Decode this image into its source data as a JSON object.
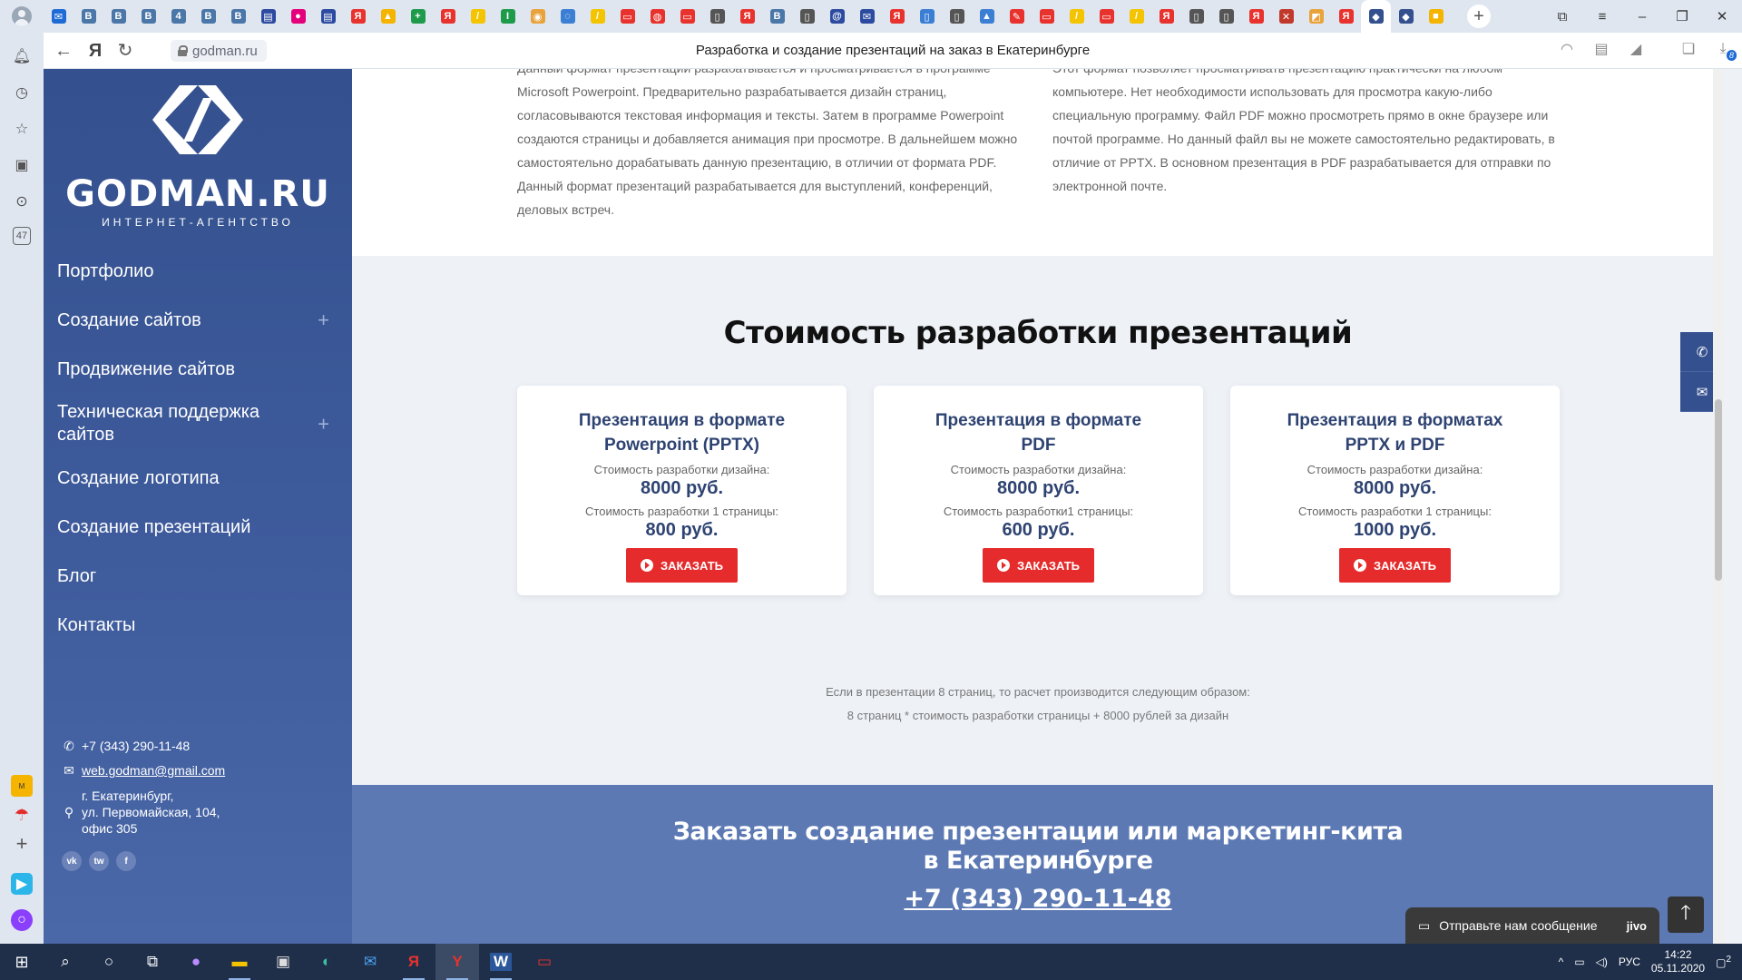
{
  "browser": {
    "tabs": [
      {
        "icon": "mail-icon",
        "glyph": "✉",
        "color": "#1f6bd6"
      },
      {
        "icon": "vk-icon",
        "glyph": "В",
        "color": "#4a76a8"
      },
      {
        "icon": "vk-icon",
        "glyph": "В",
        "color": "#4a76a8"
      },
      {
        "icon": "vk-icon",
        "glyph": "В",
        "color": "#4a76a8"
      },
      {
        "icon": "vk-icon",
        "glyph": "4",
        "color": "#4a76a8"
      },
      {
        "icon": "vk-icon",
        "glyph": "В",
        "color": "#4a76a8"
      },
      {
        "icon": "vk-icon",
        "glyph": "В",
        "color": "#4a76a8"
      },
      {
        "icon": "page-icon",
        "glyph": "▤",
        "color": "#2b4aa0"
      },
      {
        "icon": "chat-icon",
        "glyph": "●",
        "color": "#e4007c"
      },
      {
        "icon": "page-icon",
        "glyph": "▤",
        "color": "#2b4aa0"
      },
      {
        "icon": "yandex-icon",
        "glyph": "Я",
        "color": "#e8322d"
      },
      {
        "icon": "drive-icon",
        "glyph": "▲",
        "color": "#f4b400"
      },
      {
        "icon": "sheets-icon",
        "glyph": "+",
        "color": "#1e9b4a"
      },
      {
        "icon": "yandex-icon",
        "glyph": "Я",
        "color": "#e8322d"
      },
      {
        "icon": "pencil-icon",
        "glyph": "/",
        "color": "#f4c400"
      },
      {
        "icon": "sheets-icon",
        "glyph": "I",
        "color": "#1e9b4a"
      },
      {
        "icon": "chrome-icon",
        "glyph": "◉",
        "color": "#e8a33d"
      },
      {
        "icon": "doc-icon",
        "glyph": "◌",
        "color": "#3b7fd4"
      },
      {
        "icon": "pencil-icon",
        "glyph": "/",
        "color": "#f4c400"
      },
      {
        "icon": "pdf-icon",
        "glyph": "▭",
        "color": "#e8322d"
      },
      {
        "icon": "pdf-icon",
        "glyph": "◍",
        "color": "#e8322d"
      },
      {
        "icon": "pdf-icon",
        "glyph": "▭",
        "color": "#e8322d"
      },
      {
        "icon": "file-icon",
        "glyph": "▯",
        "color": "#555555"
      },
      {
        "icon": "yandex-icon",
        "glyph": "Я",
        "color": "#e8322d"
      },
      {
        "icon": "vk-icon",
        "glyph": "В",
        "color": "#4a76a8"
      },
      {
        "icon": "file-icon",
        "glyph": "▯",
        "color": "#555555"
      },
      {
        "icon": "at-icon",
        "glyph": "@",
        "color": "#2b4aa0"
      },
      {
        "icon": "mail-icon",
        "glyph": "✉",
        "color": "#2b4aa0"
      },
      {
        "icon": "yandex-icon",
        "glyph": "Я",
        "color": "#e8322d"
      },
      {
        "icon": "doc-icon",
        "glyph": "▯",
        "color": "#3b7fd4"
      },
      {
        "icon": "file-icon",
        "glyph": "▯",
        "color": "#555555"
      },
      {
        "icon": "drive-icon",
        "glyph": "▲",
        "color": "#3b7fd4"
      },
      {
        "icon": "pen-icon",
        "glyph": "✎",
        "color": "#e8322d"
      },
      {
        "icon": "pdf-icon",
        "glyph": "▭",
        "color": "#e8322d"
      },
      {
        "icon": "pencil-icon",
        "glyph": "/",
        "color": "#f4c400"
      },
      {
        "icon": "pdf-icon",
        "glyph": "▭",
        "color": "#e8322d"
      },
      {
        "icon": "pencil-icon",
        "glyph": "/",
        "color": "#f4c400"
      },
      {
        "icon": "yandex-icon",
        "glyph": "Я",
        "color": "#e8322d"
      },
      {
        "icon": "file-icon",
        "glyph": "▯",
        "color": "#555555"
      },
      {
        "icon": "file-icon",
        "glyph": "▯",
        "color": "#555555"
      },
      {
        "icon": "yandex-icon",
        "glyph": "Я",
        "color": "#e8322d"
      },
      {
        "icon": "close-red-icon",
        "glyph": "✕",
        "color": "#c0392b"
      },
      {
        "icon": "folder-icon",
        "glyph": "◩",
        "color": "#e8a33d"
      },
      {
        "icon": "yandex-icon",
        "glyph": "Я",
        "color": "#e8322d"
      },
      {
        "icon": "godman-icon",
        "glyph": "◆",
        "color": "#34508e",
        "active": true
      },
      {
        "icon": "godman-icon",
        "glyph": "◆",
        "color": "#34508e"
      },
      {
        "icon": "folder-icon",
        "glyph": "■",
        "color": "#f4b400"
      }
    ],
    "url": "godman.ru",
    "title": "Разработка и создание презентаций на заказ в Екатеринбурге",
    "downloads_badge": "8"
  },
  "sidebar": {
    "logo_text": "GODMAN.RU",
    "logo_sub": "ИНТЕРНЕТ-АГЕНТСТВО",
    "menu": [
      {
        "label": "Портфолио",
        "expand": false
      },
      {
        "label": "Создание сайтов",
        "expand": true
      },
      {
        "label": "Продвижение сайтов",
        "expand": false
      },
      {
        "label": "Техническая поддержка сайтов",
        "expand": true
      },
      {
        "label": "Создание логотипа",
        "expand": false
      },
      {
        "label": "Создание презентаций",
        "expand": false
      },
      {
        "label": "Блог",
        "expand": false
      },
      {
        "label": "Контакты",
        "expand": false
      }
    ],
    "phone": "+7 (343) 290-11-48",
    "email": "web.godman@gmail.com",
    "address": [
      "г. Екатеринбург,",
      "ул. Первомайская, 104,",
      "офис 305"
    ],
    "socials": [
      "vk",
      "tw",
      "f"
    ]
  },
  "text_section": {
    "left": [
      "Данный формат презентаций разрабатывается и просматривается в программе",
      "Microsoft Powerpoint. Предварительно разрабатывается дизайн страниц,",
      "согласовываются текстовая информация и тексты. Затем в программе Powerpoint",
      "создаются страницы и добавляется анимация при просмотре. В дальнейшем можно",
      "самостоятельно дорабатывать данную презентацию, в отличии от формата PDF.",
      "Данный формат презентаций разрабатывается для выступлений, конференций,",
      "деловых встреч."
    ],
    "right": [
      "Этот формат позволяет просматривать презентацию практически на любом",
      "компьютере. Нет необходимости использовать для просмотра какую-либо",
      "специальную программу. Файл PDF можно просмотреть прямо в окне браузере или",
      "почтой программе. Но данный файл вы не можете самостоятельно редактировать, в",
      "отличие от PPTX. В основном презентация в PDF разрабатывается для отправки по",
      "электронной почте."
    ]
  },
  "pricing": {
    "title": "Стоимость разработки презентаций",
    "cards": [
      {
        "title_l1": "Презентация в формате",
        "title_l2": "Powerpoint (PPTX)",
        "label1": "Стоимость разработки дизайна:",
        "price1": "8000 руб.",
        "label2": "Стоимость разработки 1 страницы:",
        "price2": "800 руб.",
        "button": "ЗАКАЗАТЬ"
      },
      {
        "title_l1": "Презентация в формате",
        "title_l2": "PDF",
        "label1": "Стоимость разработки дизайна:",
        "price1": "8000 руб.",
        "label2": "Стоимость  разработки1 страницы:",
        "price2": "600 руб.",
        "button": "ЗАКАЗАТЬ"
      },
      {
        "title_l1": "Презентация в форматах",
        "title_l2": "PPTX и PDF",
        "label1": "Стоимость разработки дизайна:",
        "price1": "8000 руб.",
        "label2": "Стоимость разработки 1 страницы:",
        "price2": "1000 руб.",
        "button": "ЗАКАЗАТЬ"
      }
    ],
    "note_l1": "Если в презентации 8 страниц, то расчет производится следующим образом:",
    "note_l2": "8 страниц * стоимость разработки страницы + 8000 рублей за дизайн"
  },
  "cta": {
    "title_l1": "Заказать создание презентации или маркетинг-кита",
    "title_l2": "в Екатеринбурге",
    "phone": "+7 (343) 290-11-48"
  },
  "chat": {
    "label": "Отправьте нам сообщение",
    "brand": "jivo"
  },
  "taskbar": {
    "lang": "РУС",
    "time": "14:22",
    "date": "05.11.2020",
    "notif_count": "2"
  }
}
